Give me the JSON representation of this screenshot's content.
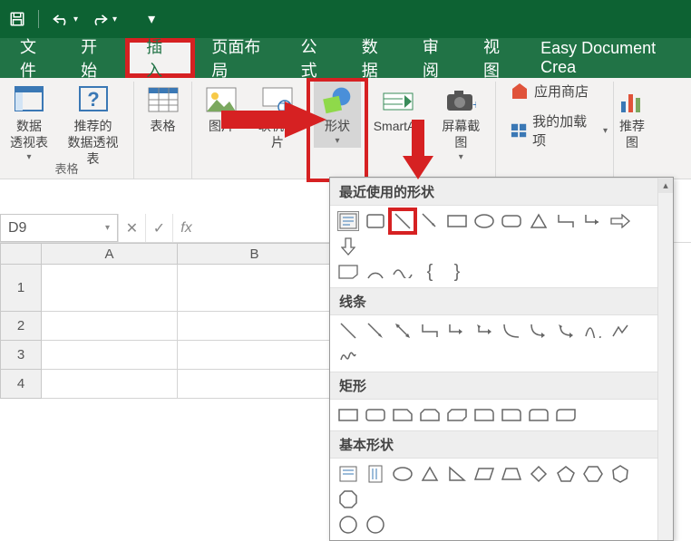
{
  "titlebar": {},
  "tabs": {
    "file": "文件",
    "home": "开始",
    "insert": "插入",
    "page_layout": "页面布局",
    "formulas": "公式",
    "data": "数据",
    "review": "审阅",
    "view": "视图",
    "easy_doc": "Easy Document Crea"
  },
  "ribbon": {
    "pivot": "数据\n透视表",
    "recommended_pivot": "推荐的\n数据透视表",
    "table": "表格",
    "group_tables_title": "表格",
    "picture": "图片",
    "online_picture": "联机图片",
    "shapes": "形状",
    "smartart": "SmartArt",
    "screenshot": "屏幕截图",
    "app_store": "应用商店",
    "my_addins": "我的加载项",
    "rec_charts": "推荐\n图"
  },
  "cellref": "D9",
  "columns": {
    "A": "A",
    "B": "B"
  },
  "rows": {
    "r1": "1",
    "r2": "2",
    "r3": "3",
    "r4": "4"
  },
  "shapes_panel": {
    "recent": "最近使用的形状",
    "lines": "线条",
    "rectangles": "矩形",
    "basic": "基本形状",
    "brace_open": "{",
    "brace_close": "}"
  }
}
